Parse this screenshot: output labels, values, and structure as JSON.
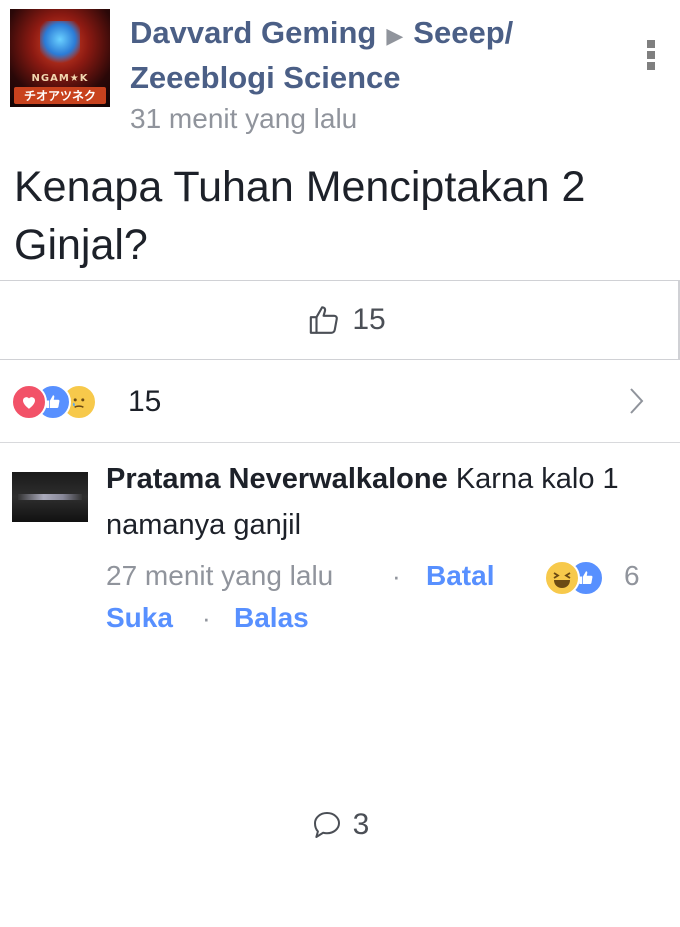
{
  "post": {
    "avatar_logo_top": "NGAM★K",
    "avatar_logo_bottom": "チオアツネク",
    "author": "Davvard Geming",
    "target_page": "Seeep/ Zeeeblogi Science",
    "time": "31 menit yang lalu",
    "text": "Kenapa Tuhan Menciptakan 2 Ginjal?"
  },
  "actions": {
    "like_count": "15",
    "comment_count": "3"
  },
  "reactions": {
    "icons": [
      "love-reaction",
      "like-reaction",
      "sad-reaction"
    ],
    "count": "15"
  },
  "comment": {
    "author": "Pratama Neverwalkalone",
    "text": "Karna kalo 1 namanya ganjil",
    "time": "27 menit yang lalu",
    "cancel_label": "Batal",
    "reactions": [
      "haha-reaction",
      "like-reaction"
    ],
    "reaction_count": "6",
    "like_label": "Suka",
    "reply_label": "Balas",
    "separator": "·"
  },
  "colors": {
    "link_blue": "#5890ff",
    "name_blue": "#4b5f86",
    "meta_gray": "#90949c",
    "love_red": "#f25268",
    "haha_yellow": "#f7c94b"
  }
}
